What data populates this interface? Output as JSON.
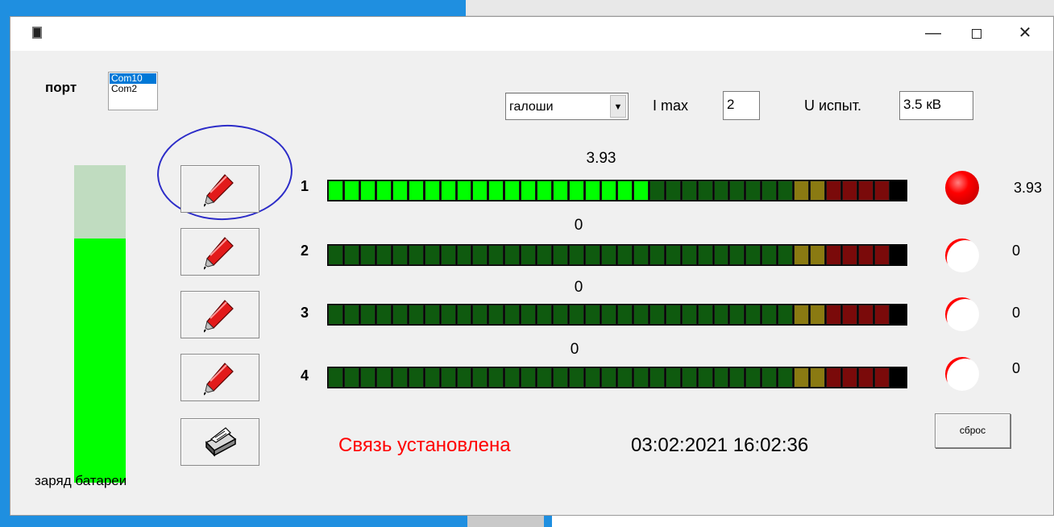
{
  "window": {
    "controls": {
      "minimize": "—",
      "close": "✕"
    }
  },
  "port": {
    "label": "порт",
    "options": [
      "Com10",
      "Com2"
    ],
    "selected_index": 0
  },
  "settings": {
    "mode_value": "галоши",
    "mode_arrow": "▼",
    "imax_label": "I max",
    "imax_value": "2",
    "utest_label": "U испыт.",
    "utest_value": "3.5 кВ"
  },
  "battery": {
    "label": "заряд батареи",
    "level_fraction": 0.77,
    "fill_color": "#00ff00",
    "empty_color": "#c0dcc0"
  },
  "tools": [
    {
      "icon": "pen-icon"
    },
    {
      "icon": "pen-icon"
    },
    {
      "icon": "pen-icon"
    },
    {
      "icon": "pen-icon"
    },
    {
      "icon": "printer-icon"
    }
  ],
  "channels": [
    {
      "number": "1",
      "value": "3.93",
      "lit_segments": 20,
      "led_active": true
    },
    {
      "number": "2",
      "value": "0",
      "lit_segments": 0,
      "led_active": false
    },
    {
      "number": "3",
      "value": "0",
      "lit_segments": 0,
      "led_active": false
    },
    {
      "number": "4",
      "value": "0",
      "lit_segments": 0,
      "led_active": false
    }
  ],
  "meter": {
    "total_segments": 36,
    "green_segments": 29,
    "yellow_segments": 2,
    "red_segments": 4,
    "colors": {
      "green_on": "#00ff00",
      "green_off": "#0f5a0f",
      "yellow": "#8a7a12",
      "red": "#7a0a0a",
      "led_on": "#ff0000"
    }
  },
  "status": {
    "connection": "Связь установлена",
    "datetime": "03:02:2021  16:02:36",
    "reset_label": "сброс"
  }
}
